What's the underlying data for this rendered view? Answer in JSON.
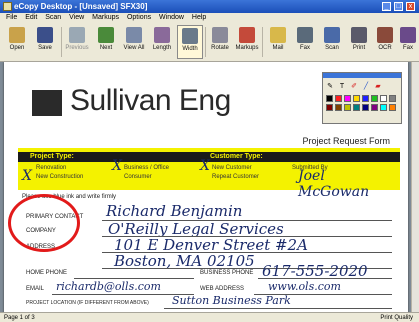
{
  "window": {
    "title": "eCopy Desktop - [Unsaved] SFX30]",
    "min_label": "_",
    "max_label": "□",
    "close_label": "x"
  },
  "menu": [
    "File",
    "Edit",
    "Scan",
    "View",
    "Markups",
    "Options",
    "Window",
    "Help"
  ],
  "toolbar": [
    {
      "label": "Open",
      "icon": "folder-open-icon",
      "color": "#c9a24a"
    },
    {
      "label": "Save",
      "icon": "save-disk-icon",
      "color": "#3b4f8a"
    },
    {
      "label": "Previous",
      "icon": "previous-arrow-icon",
      "color": "#9aa8b4",
      "disabled": true
    },
    {
      "label": "Next",
      "icon": "next-arrow-icon",
      "color": "#4a8a3a"
    },
    {
      "label": "View All",
      "icon": "view-all-icon",
      "color": "#7a8aa8"
    },
    {
      "label": "Length",
      "icon": "length-icon",
      "color": "#8a6a9a"
    },
    {
      "label": "Width",
      "icon": "width-icon",
      "color": "#6a7a8a",
      "active": true
    },
    {
      "label": "Rotate",
      "icon": "rotate-icon",
      "color": "#8a8a9a"
    },
    {
      "label": "Markups",
      "icon": "markups-pen-icon",
      "color": "#c44a3a"
    },
    {
      "label": "Mail",
      "icon": "mail-envelope-icon",
      "color": "#d8b84a"
    },
    {
      "label": "Fax",
      "icon": "fax-icon",
      "color": "#5a6a7a"
    },
    {
      "label": "Scan",
      "icon": "scan-icon",
      "color": "#4a6aa8"
    },
    {
      "label": "Print",
      "icon": "printer-icon",
      "color": "#5a5a6a"
    },
    {
      "label": "OCR",
      "icon": "ocr-icon",
      "color": "#8a4a3a"
    },
    {
      "label": "Fax",
      "icon": "fax-icon",
      "color": "#6a4a8a"
    }
  ],
  "document": {
    "logo_text": "Sullivan Eng",
    "form_title": "Project Request Form",
    "yellow": {
      "project_type_header": "Project Type:",
      "customer_type_header": "Customer Type:",
      "renovation": "Renovation",
      "new_construction": "New Construction",
      "business_office": "Business / Office",
      "consumer": "Consumer",
      "new_customer": "New Customer",
      "repeat_customer": "Repeat Customer",
      "submitted_by": "Submitted By",
      "signature": "Joel McGowan"
    },
    "instructions": "Please use blue ink and write firmly",
    "fields": {
      "primary_contact_label": "PRIMARY CONTACT",
      "primary_contact_value": "Richard Benjamin",
      "company_label": "COMPANY",
      "company_value": "O'Reilly Legal Services",
      "address_label": "ADDRESS",
      "address_value": "101 E Denver Street #2A",
      "city_value": "Boston, MA 02105",
      "home_phone_label": "HOME PHONE",
      "business_phone_label": "BUSINESS PHONE",
      "business_phone_value": "617-555-2020",
      "email_label": "EMAIL",
      "email_value": "richardb@olls.com",
      "web_label": "WEB ADDRESS",
      "web_value": "www.ols.com",
      "project_location_label": "PROJECT LOCATION (if different from above)",
      "project_location_value": "Sutton Business Park"
    }
  },
  "palette": {
    "colors": [
      "#000000",
      "#ff2020",
      "#ff00ff",
      "#ffd800",
      "#2020ff",
      "#20c020",
      "#ffffff",
      "#808080",
      "#800000",
      "#804000",
      "#c0c000",
      "#008080",
      "#000080",
      "#800080",
      "#00ffff",
      "#ff8000"
    ],
    "tools": [
      "pen-tool-icon",
      "text-tool-icon",
      "highlighter-icon",
      "line-tool-icon",
      "eraser-icon"
    ]
  },
  "status": {
    "page": "Page 1 of 3",
    "quality": "Print Quality"
  },
  "annotation_color": "#e21a1a"
}
